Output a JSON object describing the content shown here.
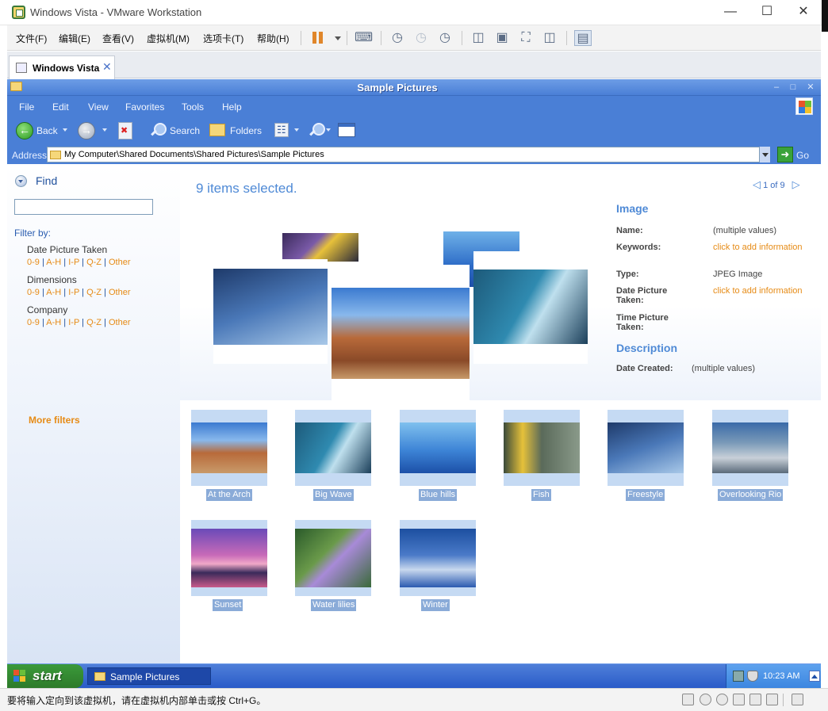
{
  "host": {
    "window_title": "Windows Vista - VMware Workstation",
    "controls": {
      "minimize": "—",
      "maximize": "☐",
      "close": "✕"
    },
    "menus": [
      "文件(F)",
      "编辑(E)",
      "查看(V)",
      "虚拟机(M)",
      "选项卡(T)",
      "帮助(H)"
    ],
    "toolbar_icons": [
      "pause-icon",
      "send-keys-icon",
      "snapshot-take-icon",
      "snapshot-revert-icon",
      "snapshot-manager-icon",
      "library-view-icon",
      "console-view-icon",
      "fullscreen-icon",
      "unity-icon",
      "thumbnail-bar-icon"
    ],
    "tab_label": "Windows Vista",
    "tab_close": "✕",
    "status_hint": "要将输入定向到该虚拟机，请在虚拟机内部单击或按 Ctrl+G。",
    "status_icons": [
      "hard-disk-icon",
      "cd-dvd-icon",
      "cd-dvd-2-icon",
      "network-icon",
      "printer-icon",
      "sound-icon",
      "message-icon"
    ]
  },
  "explorer": {
    "title": "Sample Pictures",
    "title_controls": {
      "minimize": "–",
      "maximize": "□",
      "close": "✕"
    },
    "menus": [
      "File",
      "Edit",
      "View",
      "Favorites",
      "Tools",
      "Help"
    ],
    "toolbar": {
      "back": "Back",
      "search": "Search",
      "folders": "Folders"
    },
    "address": {
      "label": "Address",
      "path": "My Computer\\Shared Documents\\Shared Pictures\\Sample Pictures",
      "go": "Go"
    }
  },
  "find_pane": {
    "title": "Find",
    "search_value": "",
    "filter_by": "Filter by:",
    "groups": [
      {
        "name": "Date Picture Taken",
        "links": [
          "0-9",
          "A-H",
          "I-P",
          "Q-Z",
          "Other"
        ]
      },
      {
        "name": "Dimensions",
        "links": [
          "0-9",
          "A-H",
          "I-P",
          "Q-Z",
          "Other"
        ]
      },
      {
        "name": "Company",
        "links": [
          "0-9",
          "A-H",
          "I-P",
          "Q-Z",
          "Other"
        ]
      }
    ],
    "more_filters": "More filters"
  },
  "preview": {
    "selection_text": "9 items selected.",
    "pager": "1 of 9",
    "pager_prev": "◁",
    "pager_next": "▷"
  },
  "details": {
    "image_section": "Image",
    "fields": [
      {
        "key": "Name:",
        "value": "(multiple values)",
        "link": false
      },
      {
        "key": "Keywords:",
        "value": "click to add information",
        "link": true
      },
      {
        "key": "Type:",
        "value": "JPEG Image",
        "link": false
      },
      {
        "key": "Date Picture Taken:",
        "value": "click to add information",
        "link": true
      },
      {
        "key": "Time Picture Taken:",
        "value": "",
        "link": false
      }
    ],
    "description_section": "Description",
    "date_created_key": "Date Created:",
    "date_created_value": "(multiple values)"
  },
  "thumbnails": [
    {
      "label": "At the Arch"
    },
    {
      "label": "Big Wave"
    },
    {
      "label": "Blue hills"
    },
    {
      "label": "Fish"
    },
    {
      "label": "Freestyle"
    },
    {
      "label": "Overlooking Rio"
    },
    {
      "label": "Sunset"
    },
    {
      "label": "Water lilies"
    },
    {
      "label": "Winter"
    }
  ],
  "taskbar": {
    "start": "start",
    "task_label": "Sample Pictures",
    "clock": "10:23 AM"
  },
  "colors": {
    "xp_blue": "#4a7fd6",
    "link_orange": "#e68b16",
    "selection_blue": "#8aabd8",
    "start_green": "#3b9a3a"
  }
}
